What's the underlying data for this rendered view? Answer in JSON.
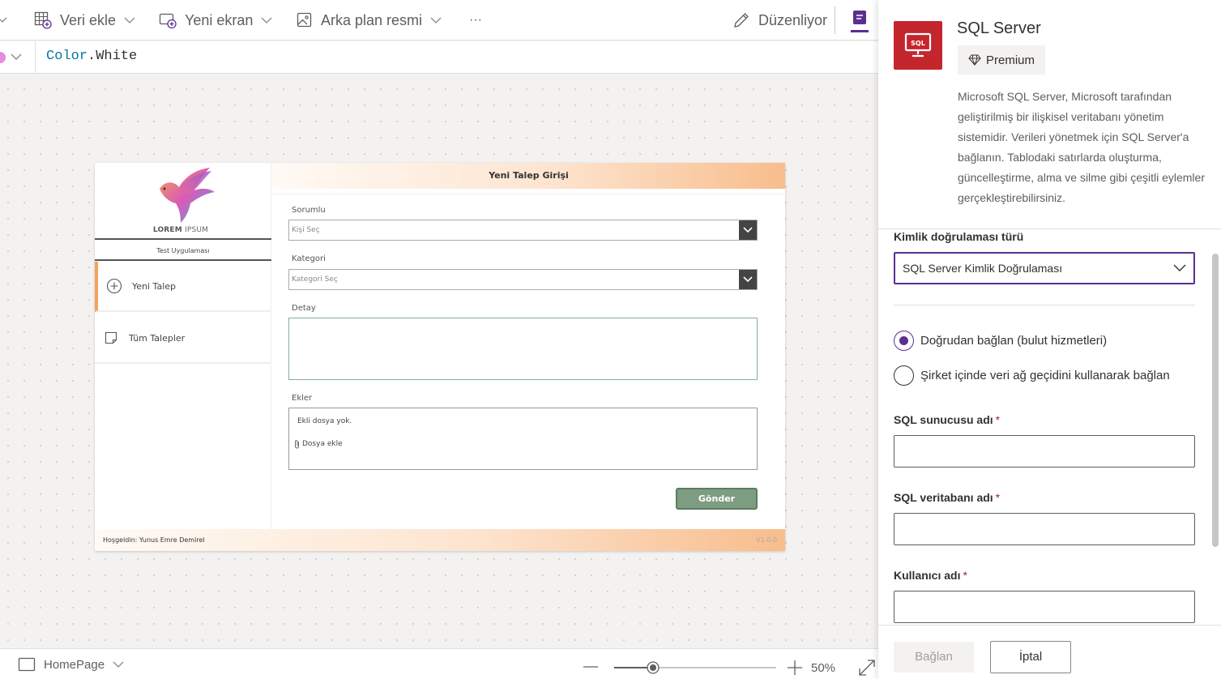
{
  "toolbar": {
    "veri_ekle": "Veri ekle",
    "yeni_ekran": "Yeni ekran",
    "arka_plan": "Arka plan resmi",
    "more": "···",
    "duzenliyor": "Düzenliyor"
  },
  "formula": {
    "object": "Color",
    "dot": ".",
    "prop": "White"
  },
  "app": {
    "logo_bold": "LOREM",
    "logo_light": " IPSUM",
    "subtitle": "Test Uygulaması",
    "nav": [
      "Yeni Talep",
      "Tüm Talepler"
    ],
    "header": "Yeni Talep Girişi",
    "fields": {
      "sorumlu_label": "Sorumlu",
      "sorumlu_placeholder": "Kişi Seç",
      "kategori_label": "Kategori",
      "kategori_placeholder": "Kategori Seç",
      "detay_label": "Detay",
      "ekler_label": "Ekler",
      "ekler_empty": "Ekli dosya yok.",
      "ekler_add": "Dosya ekle"
    },
    "submit": "Gönder",
    "footer_welcome": "Hoşgeldin: Yunus Emre Demirel",
    "footer_version": "V1.0.0"
  },
  "status": {
    "screen": "HomePage",
    "zoom": "50%",
    "zoom_level": 0.5
  },
  "panel": {
    "title": "SQL Server",
    "premium": "Premium",
    "description": "Microsoft SQL Server, Microsoft tarafından geliştirilmiş bir ilişkisel veritabanı yönetim sistemidir. Verileri yönetmek için SQL Server'a bağlanın. Tablodaki satırlarda oluşturma, güncelleştirme, alma ve silme gibi çeşitli eylemler gerçekleştirebilirsiniz.",
    "auth_label": "Kimlik doğrulaması türü",
    "auth_value": "SQL Server Kimlik Doğrulaması",
    "radio_direct": "Doğrudan bağlan (bulut hizmetleri)",
    "radio_gateway": "Şirket içinde veri ağ geçidini kullanarak bağlan",
    "server_label": "SQL sunucusu adı",
    "db_label": "SQL veritabanı adı",
    "user_label": "Kullanıcı adı",
    "required_mark": "*",
    "connect": "Bağlan",
    "cancel": "İptal"
  },
  "colors": {
    "accent": "#5c2e91",
    "sql_brand": "#c4262e",
    "app_accent": "#f5a35e",
    "submit_green": "#7d9c82"
  }
}
